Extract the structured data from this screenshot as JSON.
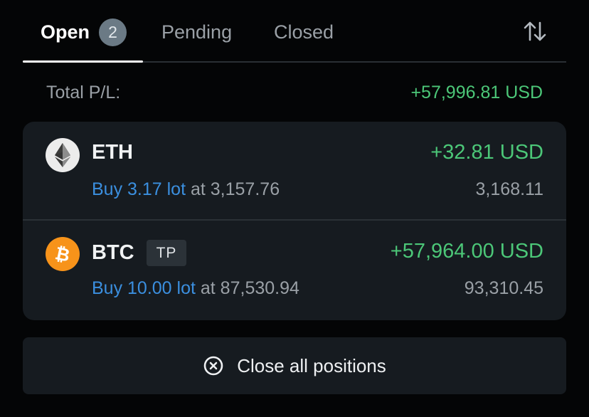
{
  "tabs": {
    "open_label": "Open",
    "open_count": "2",
    "pending_label": "Pending",
    "closed_label": "Closed"
  },
  "summary": {
    "total_label": "Total P/L:",
    "total_value": "+57,996.81 USD"
  },
  "positions": [
    {
      "symbol": "ETH",
      "icon": "ethereum-icon",
      "pl": "+32.81 USD",
      "side_lot": "Buy 3.17 lot",
      "at_text": "at 3,157.76",
      "current_price": "3,168.11"
    },
    {
      "symbol": "BTC",
      "icon": "bitcoin-icon",
      "tag": "TP",
      "pl": "+57,964.00 USD",
      "side_lot": "Buy 10.00 lot",
      "at_text": "at 87,530.94",
      "current_price": "93,310.45"
    }
  ],
  "actions": {
    "close_all_label": "Close all positions"
  },
  "colors": {
    "background": "#040506",
    "card": "#161b20",
    "profit_green": "#4cc778",
    "link_blue": "#3b8fdf",
    "btc_orange": "#f7931a"
  }
}
